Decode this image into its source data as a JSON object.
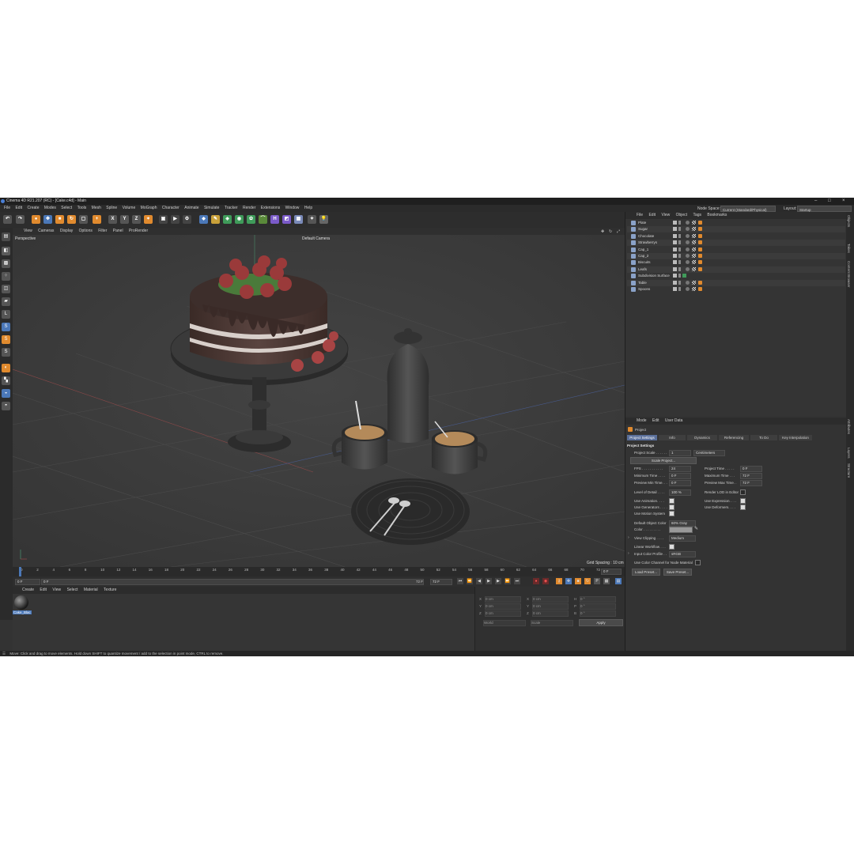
{
  "window": {
    "title": "Cinema 4D R21.207 (RC) - [Cake.c4d] - Main",
    "buttons": [
      "–",
      "□",
      "×"
    ]
  },
  "menubar": {
    "items": [
      "File",
      "Edit",
      "Create",
      "Modes",
      "Select",
      "Tools",
      "Mesh",
      "Spline",
      "Volume",
      "MoGraph",
      "Character",
      "Animate",
      "Simulate",
      "Tracker",
      "Render",
      "Extensions",
      "Window",
      "Help"
    ],
    "node_space_label": "Node Space:",
    "node_space_value": "Current (Standard/Physical)",
    "layout_label": "Layout:",
    "layout_value": "Startup"
  },
  "toolbar": {
    "axis_buttons": [
      "X",
      "Y",
      "Z"
    ]
  },
  "viewport": {
    "menu": [
      "View",
      "Cameras",
      "Display",
      "Options",
      "Filter",
      "Panel",
      "ProRender"
    ],
    "name": "Perspective",
    "camera": "Default Camera",
    "grid_spacing": "Grid Spacing : 10 cm"
  },
  "timeline": {
    "ticks": [
      "0",
      "2",
      "4",
      "6",
      "8",
      "10",
      "12",
      "14",
      "16",
      "18",
      "20",
      "22",
      "24",
      "26",
      "28",
      "30",
      "32",
      "34",
      "36",
      "38",
      "40",
      "42",
      "44",
      "46",
      "48",
      "50",
      "52",
      "54",
      "56",
      "58",
      "60",
      "62",
      "64",
      "66",
      "68",
      "70",
      "72"
    ],
    "current_frame_field": "0 F",
    "range_start": "0 F",
    "range_end_label": "72 F",
    "range_end_field": "72 F",
    "end_readout": "0 F"
  },
  "material_manager": {
    "menu": [
      "Create",
      "Edit",
      "View",
      "Select",
      "Material",
      "Texture"
    ],
    "materials": [
      {
        "name": "Cake_Blac"
      }
    ]
  },
  "coordinates": {
    "rows": [
      {
        "axis": "X",
        "pos": "0 cm",
        "axis2": "X",
        "size": "0 cm",
        "axis3": "H",
        "rot": "0 °"
      },
      {
        "axis": "Y",
        "pos": "0 cm",
        "axis2": "Y",
        "size": "0 cm",
        "axis3": "P",
        "rot": "0 °"
      },
      {
        "axis": "Z",
        "pos": "0 cm",
        "axis2": "Z",
        "size": "0 cm",
        "axis3": "B",
        "rot": "0 °"
      }
    ],
    "mode": "World",
    "scale_mode": "Scale",
    "apply": "Apply"
  },
  "object_manager": {
    "menu": [
      "File",
      "Edit",
      "View",
      "Object",
      "Tags",
      "Bookmarks"
    ],
    "objects": [
      {
        "name": "Plate"
      },
      {
        "name": "Sugar"
      },
      {
        "name": "Chocolate"
      },
      {
        "name": "Strawberrys"
      },
      {
        "name": "Cap_1"
      },
      {
        "name": "Cap_2"
      },
      {
        "name": "Biscuits"
      },
      {
        "name": "Leafs"
      },
      {
        "name": "Subdivision Surface"
      },
      {
        "name": "Table"
      },
      {
        "name": "Spoons"
      }
    ]
  },
  "attributes": {
    "menu": [
      "Mode",
      "Edit",
      "User Data"
    ],
    "object": "Project",
    "tabs": [
      "Project Settings",
      "Info",
      "Dynamics",
      "Referencing",
      "To Do",
      "Key Interpolation"
    ],
    "section": "Project Settings",
    "project_scale_label": "Project Scale . . . . . .",
    "project_scale_value": "1",
    "project_scale_unit": "Centimeters",
    "scale_project_button": "Scale Project...",
    "fps_label": "FPS . . . . . . . . . . .",
    "fps_value": "24",
    "project_time_label": "Project Time . . . . .",
    "project_time_value": "0 F",
    "min_time_label": "Minimum Time . . . .",
    "min_time_value": "0 F",
    "max_time_label": "Maximum Time . . .",
    "max_time_value": "72 F",
    "prev_min_label": "Preview Min Time. . .",
    "prev_min_value": "0 F",
    "prev_max_label": "Preview Max Time. .",
    "prev_max_value": "72 F",
    "lod_label": "Level of Detail . . . .",
    "lod_value": "100 %",
    "render_lod_label": "Render LOD in Editor",
    "use_animation_label": "Use Animation. . . .",
    "use_expression_label": "Use Expression. . . .",
    "use_generators_label": "Use Generators . . . .",
    "use_deformers_label": "Use Deformers. . . .",
    "use_motion_label": "Use Motion System",
    "default_color_label": "Default Object Color",
    "default_color_value": "60% Gray",
    "color_label": "Color . . . . . . . . .",
    "view_clipping_label": "View Clipping . . . .",
    "view_clipping_value": "Medium",
    "linear_workflow_label": "Linear Workflow . . .",
    "input_profile_label": "Input Color Profile . .",
    "input_profile_value": "sRGB",
    "node_material_label": "Use Color Channel for Node Material",
    "load_preset": "Load Preset...",
    "save_preset": "Save Preset..."
  },
  "right_tabs": [
    "Objects",
    "Takes",
    "Content Browser",
    "Attributes",
    "Layers",
    "Structure"
  ],
  "status": "Move: Click and drag to move elements. Hold down SHIFT to quantize movement / add to the selection in point mode, CTRL to remove."
}
